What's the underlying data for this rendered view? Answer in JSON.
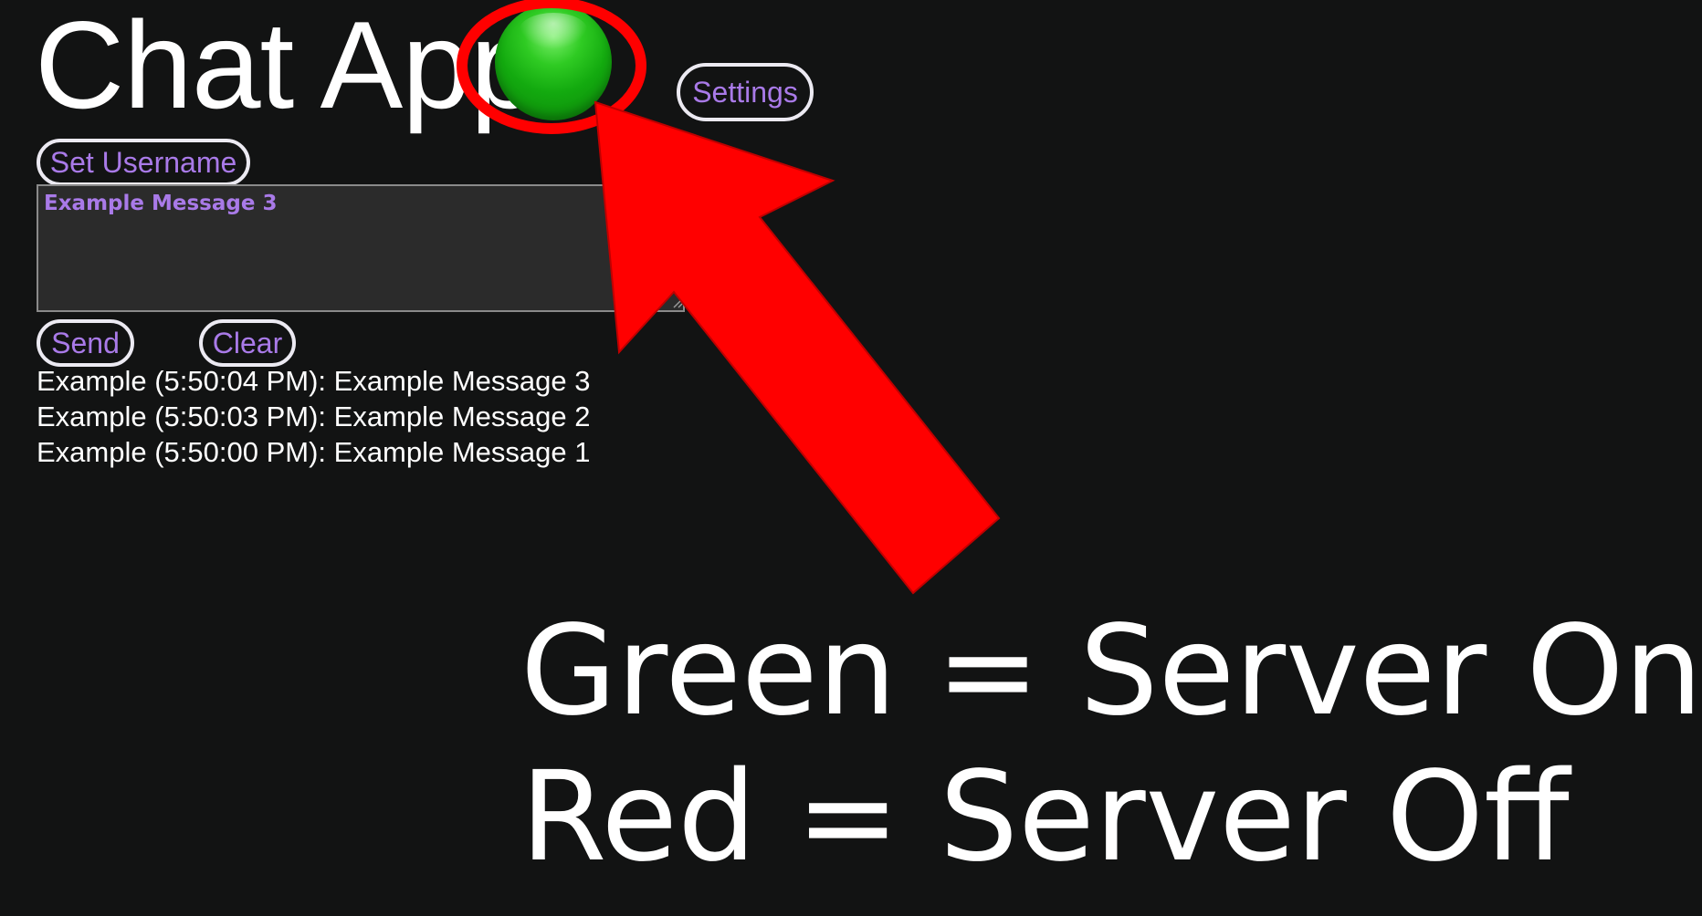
{
  "app": {
    "title": "Chat App",
    "status": "green"
  },
  "header": {
    "settings_label": "Settings"
  },
  "controls": {
    "set_username_label": "Set Username",
    "send_label": "Send",
    "clear_label": "Clear"
  },
  "composer": {
    "value": "Example Message 3"
  },
  "messages": [
    "Example (5:50:04 PM): Example Message 3",
    "Example (5:50:03 PM): Example Message 2",
    "Example (5:50:00 PM): Example Message 1"
  ],
  "annotation": {
    "legend_green": "Green = Server On",
    "legend_red": "Red = Server Off"
  },
  "colors": {
    "background": "#121313",
    "accent_text": "#a97ae8",
    "status_green": "#13aa0f",
    "annotation_red": "#ff0000"
  }
}
